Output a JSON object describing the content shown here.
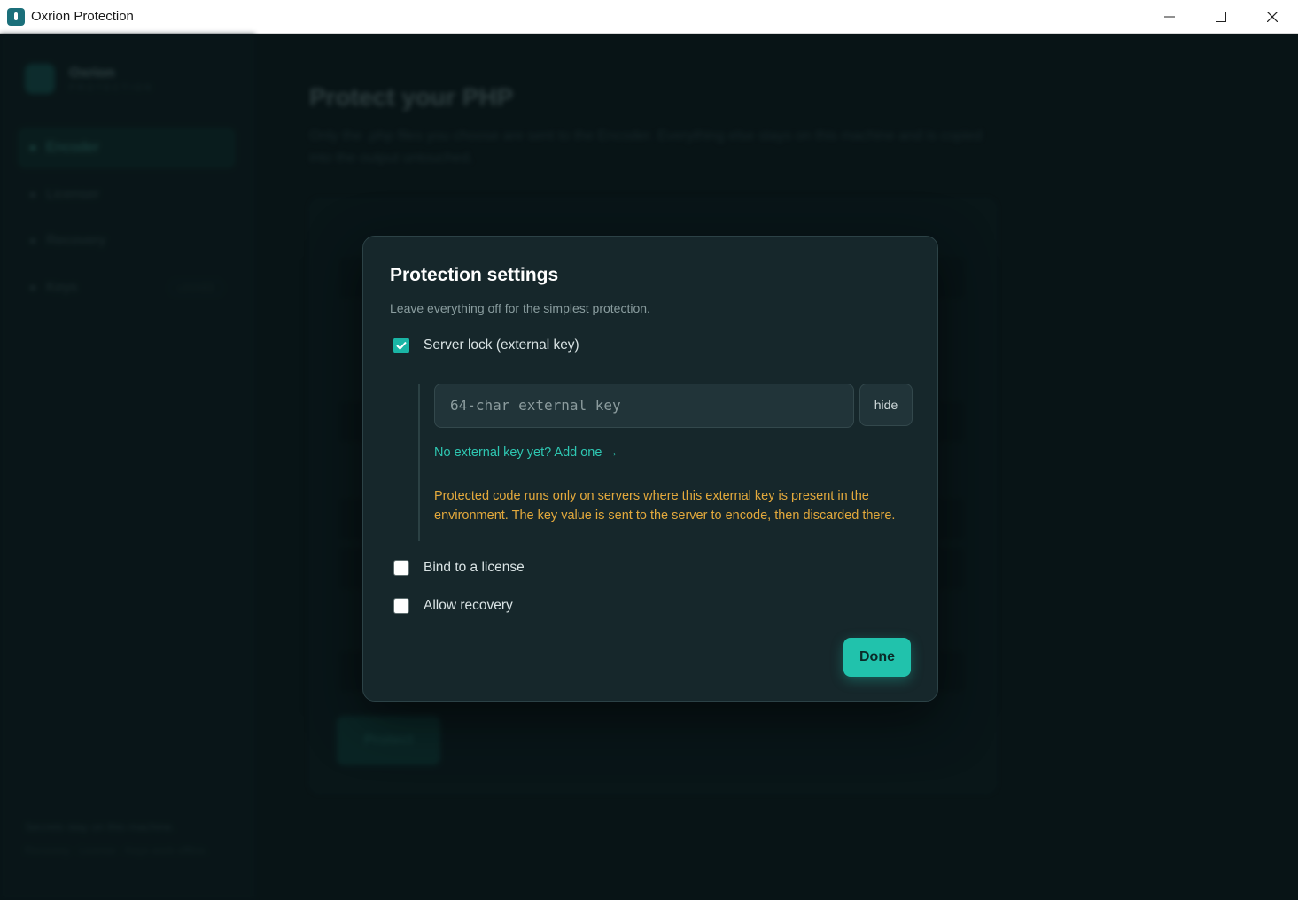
{
  "window": {
    "title": "Oxrion Protection"
  },
  "sidebar": {
    "brand_name": "Oxrion",
    "brand_sub": "PROTECTION",
    "items": [
      {
        "label": "Encoder"
      },
      {
        "label": "Licenser"
      },
      {
        "label": "Recovery"
      },
      {
        "label": "Keys",
        "badge": "LOCKED"
      }
    ],
    "footer_line1": "Secrets stay on this machine.",
    "footer_line2": "Recovery · License · Keys work offline."
  },
  "main": {
    "title": "Protect your PHP",
    "subtitle": "Only the .php files you choose are sent to the Encoder. Everything else stays on this machine and is copied into the output untouched.",
    "protect_label": "Protect"
  },
  "modal": {
    "title": "Protection settings",
    "subtitle": "Leave everything off for the simplest protection.",
    "options": [
      {
        "label": "Server lock (external key)",
        "checked": true
      },
      {
        "label": "Bind to a license",
        "checked": false
      },
      {
        "label": "Allow recovery",
        "checked": false
      }
    ],
    "key_input": {
      "placeholder": "64-char external key",
      "value": ""
    },
    "hide_label": "hide",
    "add_key_link": "No external key yet? Add one →",
    "warning": "Protected code runs only on servers where this external key is present in the environment. The key value is sent to the server to encode, then discarded there.",
    "done_label": "Done"
  },
  "colors": {
    "accent": "#21c2ac",
    "warning": "#e3a93c",
    "modal_bg": "#16272b"
  }
}
